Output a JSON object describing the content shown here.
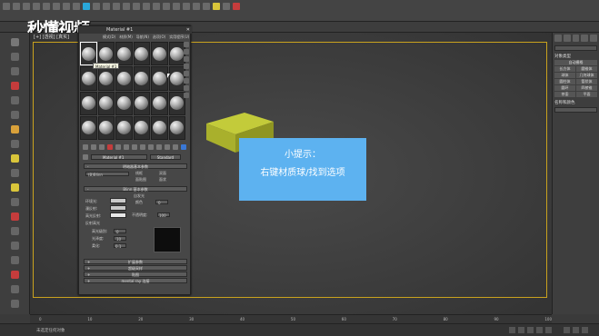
{
  "watermark": "秒懂视频",
  "viewport": {
    "label": "[+] [透视] [真实]"
  },
  "hint": {
    "title": "小提示：",
    "body": "右键材质球/找到选项"
  },
  "material_editor": {
    "title": "Material #1",
    "close": "✕",
    "menu": [
      "模式(D)",
      "材质(M)",
      "导航(N)",
      "选项(O)",
      "实用程序(U)"
    ],
    "slot_count": 24,
    "tooltip": "Material #1",
    "name_field": "Material #1",
    "type_button": "Standard",
    "shader_rollout": "明暗器基本参数",
    "shader_value": "(B)Blinn",
    "shader_options": [
      "线框",
      "双面",
      "面贴图",
      "面状"
    ],
    "basic_rollout": "Blinn 基本参数",
    "basic_labels": [
      "环境光:",
      "漫反射:",
      "高光反射:"
    ],
    "self_illum_label": "自发光",
    "color_label": "颜色",
    "color_value": "0",
    "opacity_label": "不透明度:",
    "opacity_value": "100",
    "specular_section": "反射高光",
    "specular_labels": [
      "高光级别:",
      "光泽度:",
      "柔化:"
    ],
    "specular_values": [
      "0",
      "10",
      "0.1"
    ],
    "extra_rollouts": [
      "扩展参数",
      "超级采样",
      "贴图",
      "mental ray 连接"
    ]
  },
  "right_panel": {
    "field": "",
    "section1": "对象类型",
    "auto_grid": "自动栅格",
    "buttons": [
      "长方体",
      "圆锥体",
      "球体",
      "几何球体",
      "圆柱体",
      "管状体",
      "圆环",
      "四棱锥",
      "茶壶",
      "平面"
    ],
    "section2": "名称和颜色"
  },
  "timeline": {
    "ticks": [
      "0",
      "10",
      "20",
      "30",
      "40",
      "50",
      "60",
      "70",
      "80",
      "90",
      "100"
    ]
  },
  "status": {
    "text": "未选定任何对象"
  },
  "colors": {
    "hint_bg": "#5db2f0",
    "viewport_frame": "#c9a21e",
    "box_top": "#c3cb3a",
    "box_side": "#9aa026"
  }
}
